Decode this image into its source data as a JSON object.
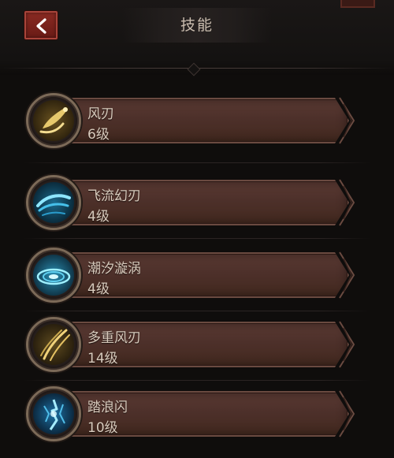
{
  "header": {
    "title": "技能",
    "back_icon": "chevron-left-icon"
  },
  "skills": [
    {
      "name": "风刃",
      "level": "6级",
      "icon": "wind-blade-icon",
      "accent": "#d9b65a"
    },
    {
      "name": "飞流幻刃",
      "level": "4级",
      "icon": "flowing-blade-icon",
      "accent": "#3fb4e0"
    },
    {
      "name": "潮汐漩涡",
      "level": "4级",
      "icon": "tide-vortex-icon",
      "accent": "#4cc2e6"
    },
    {
      "name": "多重风刃",
      "level": "14级",
      "icon": "multi-wind-blade-icon",
      "accent": "#d9b65a"
    },
    {
      "name": "踏浪闪",
      "level": "10级",
      "icon": "wave-step-icon",
      "accent": "#3aa6e0"
    }
  ]
}
